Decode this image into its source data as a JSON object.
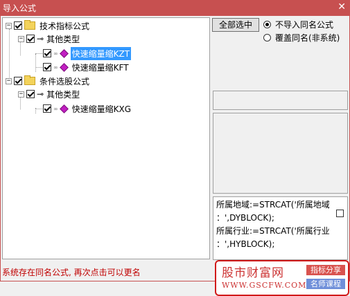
{
  "window": {
    "title": "导入公式",
    "close_label": "✕"
  },
  "tree": {
    "root1": {
      "label": "技术指标公式",
      "checked": true,
      "expanded": true
    },
    "root1_child": {
      "label": "其他类型",
      "checked": true,
      "expanded": true
    },
    "root1_items": [
      {
        "label": "快速缩量缩KZT",
        "checked": true,
        "selected": true
      },
      {
        "label": "快速缩量缩KFT",
        "checked": true,
        "selected": false
      }
    ],
    "root2": {
      "label": "条件选股公式",
      "checked": true,
      "expanded": true
    },
    "root2_child": {
      "label": "其他类型",
      "checked": true,
      "expanded": true
    },
    "root2_items": [
      {
        "label": "快速缩量缩KXG",
        "checked": true,
        "selected": false
      }
    ],
    "expander_symbol": "−"
  },
  "right_panel": {
    "select_all_button": "全部选中",
    "radio_options": [
      {
        "label": "不导入同名公式",
        "selected": true
      },
      {
        "label": "覆盖同名(非系统)",
        "selected": false
      }
    ]
  },
  "code_preview": {
    "lines": [
      "所属地域:=STRCAT('所属地域",
      "：',DYBLOCK);",
      "所属行业:=STRCAT('所属行业",
      "：',HYBLOCK);"
    ]
  },
  "status_text": "系统存在同名公式, 再次点击可以更名",
  "watermark": {
    "title": "股市财富网",
    "url": "WWW.GSCFW.COM",
    "tag1": "指标分享",
    "tag2": "名师课程"
  },
  "colors": {
    "titlebar": "#c75050",
    "selection": "#3399ff",
    "status": "#c00000",
    "watermark_border": "#d11a1a"
  }
}
